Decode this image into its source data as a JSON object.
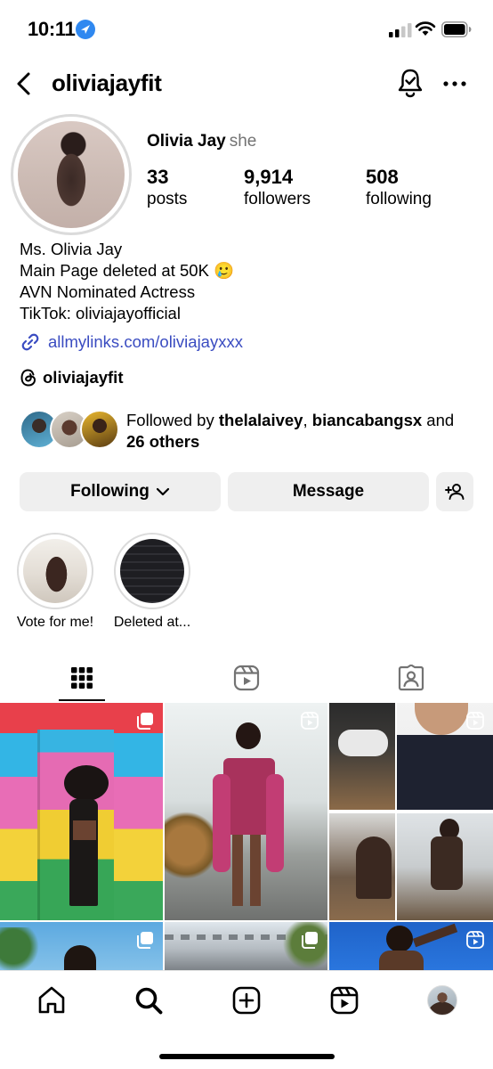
{
  "status_bar": {
    "time": "10:11"
  },
  "header": {
    "username": "oliviajayfit"
  },
  "profile": {
    "display_name": "Olivia Jay",
    "pronouns": "she",
    "stats": [
      {
        "value": "33",
        "label": "posts"
      },
      {
        "value": "9,914",
        "label": "followers"
      },
      {
        "value": "508",
        "label": "following"
      }
    ],
    "bio": [
      "Ms. Olivia Jay",
      "Main Page deleted at 50K 🥲",
      "AVN Nominated Actress",
      "TikTok: oliviajayofficial"
    ],
    "link": "allmylinks.com/oliviajayxxx",
    "threads_handle": "oliviajayfit",
    "followed_by": {
      "prefix": "Followed by ",
      "user1": "thelalaivey",
      "sep": ", ",
      "user2": "biancabangsx",
      "and": " and",
      "others": "26 others"
    }
  },
  "actions": {
    "following_label": "Following",
    "message_label": "Message"
  },
  "highlights": [
    {
      "label": "Vote for me!"
    },
    {
      "label": "Deleted at..."
    }
  ],
  "tabs": [
    {
      "name": "posts",
      "icon": "grid-icon",
      "active": true
    },
    {
      "name": "reels",
      "icon": "reels-icon",
      "active": false
    },
    {
      "name": "tagged",
      "icon": "tagged-icon",
      "active": false
    }
  ],
  "colors": {
    "link": "#3a4cc1",
    "button_bg": "#efefef",
    "location_badge": "#2f88f0"
  }
}
